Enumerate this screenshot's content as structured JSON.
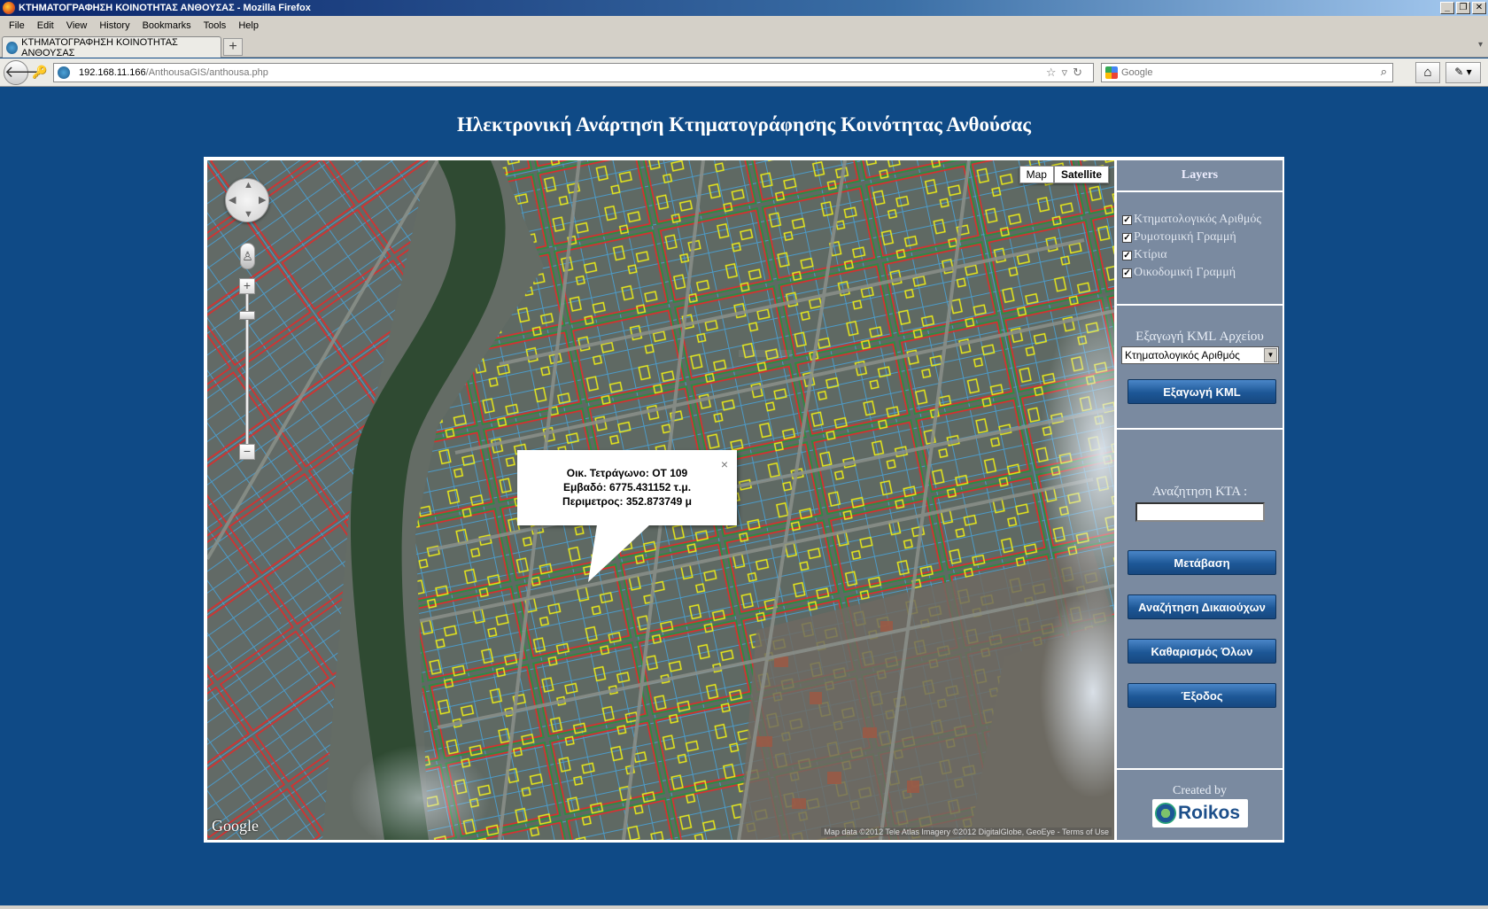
{
  "window": {
    "title": "ΚΤΗΜΑΤΟΓΡΑΦΗΣΗ ΚΟΙΝΟΤΗΤΑΣ ΑΝΘΟΥΣΑΣ - Mozilla Firefox",
    "buttons": [
      "_",
      "❐",
      "✕"
    ]
  },
  "menu": {
    "file": "File",
    "edit": "Edit",
    "view": "View",
    "history": "History",
    "bookmarks": "Bookmarks",
    "tools": "Tools",
    "help": "Help"
  },
  "tab": {
    "label": "ΚΤΗΜΑΤΟΓΡΑΦΗΣΗ ΚΟΙΝΟΤΗΤΑΣ ΑΝΘΟΥΣΑΣ",
    "new_tab": "+"
  },
  "address": {
    "host": "192.168.11.166",
    "path": "/AnthousaGIS/anthousa.php"
  },
  "search": {
    "placeholder": "Google"
  },
  "page": {
    "title": "Ηλεκτρονική Ανάρτηση Κτηματογράφησης Κοινότητας Ανθούσας"
  },
  "map": {
    "type_buttons": {
      "map": "Map",
      "satellite": "Satellite",
      "active": "satellite"
    },
    "infowindow": {
      "line1": "Οικ. Τετράγωνο: ΟΤ 109",
      "line2": "Εμβαδό: 6775.431152 τ.μ.",
      "line3": "Περιμετρος: 352.873749 μ",
      "close": "×"
    },
    "google_logo": "Google",
    "attribution": "Map data ©2012 Tele Atlas Imagery ©2012 DigitalGlobe, GeoEye - Terms of Use",
    "colors": {
      "parcel_line": "#e02b2b",
      "road_line": "#4c9ac7",
      "building_line": "#e8e81a",
      "block_line": "#2f8a46"
    }
  },
  "panel": {
    "layers_title": "Layers",
    "layers": [
      {
        "label": "Κτηματολογικός Αριθμός",
        "checked": true
      },
      {
        "label": "Ρυμοτομική Γραμμή",
        "checked": true
      },
      {
        "label": "Κτίρια",
        "checked": true
      },
      {
        "label": "Οικοδομική Γραμμή",
        "checked": true
      }
    ],
    "export_label": "Εξαγωγή KML Αρχείου",
    "export_select": "Κτηματολογικός Αριθμός",
    "export_button": "Εξαγωγή KML",
    "search_label": "Αναζητηση ΚΤΑ :",
    "search_value": "",
    "buttons": {
      "go": "Μετάβαση",
      "owners": "Αναζήτηση Δικαιούχων",
      "clear": "Καθαρισμός Όλων",
      "exit": "Έξοδος"
    },
    "created_by": "Created by",
    "logo_text": "Roikos"
  }
}
